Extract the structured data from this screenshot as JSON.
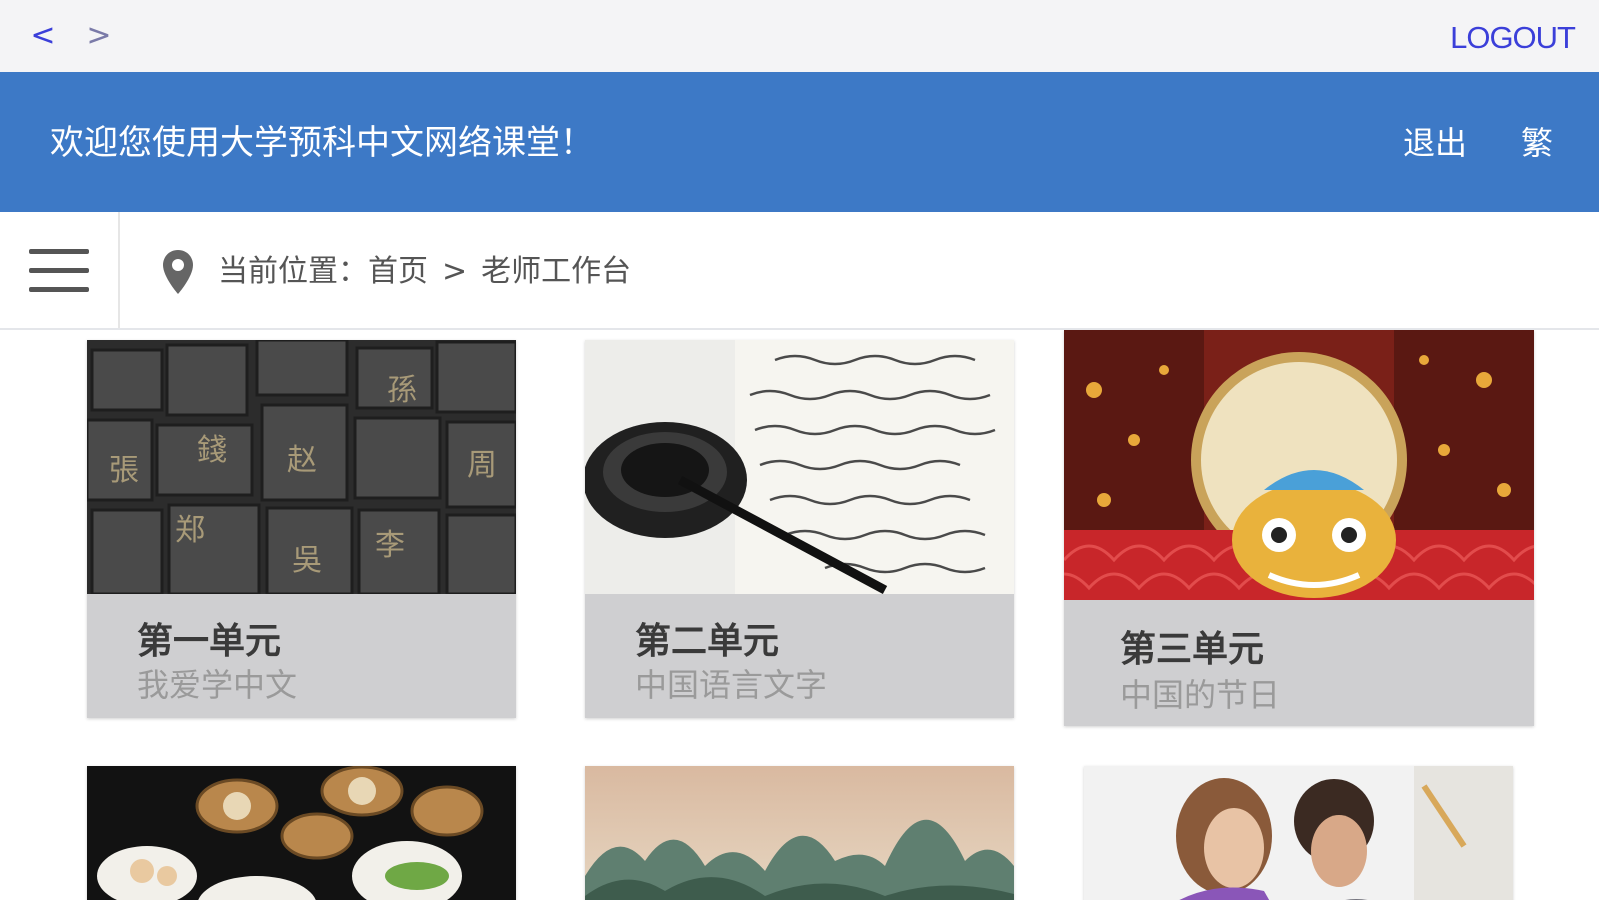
{
  "topbar": {
    "back_label": "<",
    "forward_label": ">",
    "logout_label": "LOGOUT"
  },
  "header": {
    "welcome": "欢迎您使用大学预科中文网络课堂！",
    "exit_label": "退出",
    "traditional_label": "繁",
    "background_color": "#3d79c6"
  },
  "breadcrumb": {
    "prefix": "当前位置：",
    "home": "首页",
    "separator": ">",
    "current": "老师工作台"
  },
  "units": [
    {
      "title": "第一单元",
      "subtitle": "我爱学中文",
      "image": "movable-type-blocks"
    },
    {
      "title": "第二单元",
      "subtitle": "中国语言文字",
      "image": "calligraphy-inkstone"
    },
    {
      "title": "第三单元",
      "subtitle": "中国的节日",
      "image": "lion-dance-festival"
    },
    {
      "title": "",
      "subtitle": "",
      "image": "dim-sum-food"
    },
    {
      "title": "",
      "subtitle": "",
      "image": "karst-mountains"
    },
    {
      "title": "",
      "subtitle": "",
      "image": "students-studying"
    }
  ]
}
